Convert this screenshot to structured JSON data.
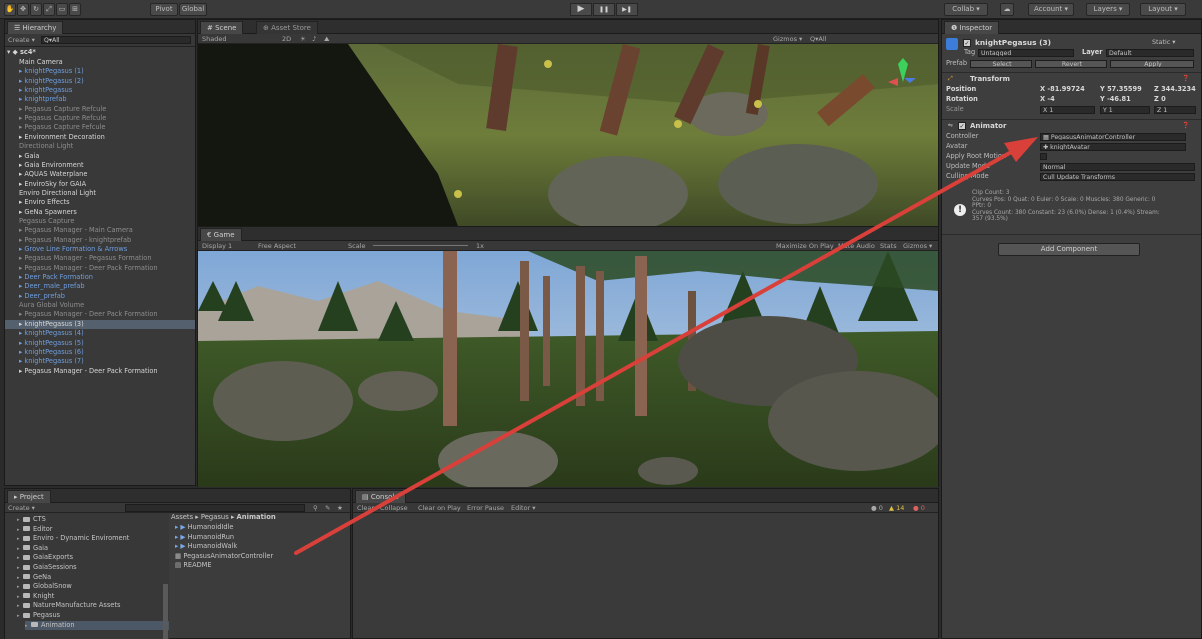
{
  "toolbar": {
    "pivot_label": "Pivot",
    "global_label": "Global",
    "play_icon": "▶",
    "pause_icon": "❚❚",
    "step_icon": "▶❚",
    "collab_label": "Collab ▾",
    "account_label": "Account ▾",
    "layers_label": "Layers ▾",
    "layout_label": "Layout ▾"
  },
  "hierarchy": {
    "tab_label": "☰ Hierarchy",
    "create_label": "Create ▾",
    "search_placeholder": "Q▾All",
    "scene_name": "sc4*",
    "items": [
      {
        "label": "Main Camera",
        "color": "white"
      },
      {
        "label": "▸ knightPegasus (1)",
        "color": "blue"
      },
      {
        "label": "▸ knightPegasus (2)",
        "color": "blue"
      },
      {
        "label": "▸ knightPegasus",
        "color": "blue"
      },
      {
        "label": "▸ knightprefab",
        "color": "blue"
      },
      {
        "label": "▸ Pegasus Capture Refcule",
        "color": "grey"
      },
      {
        "label": "▸ Pegasus Capture Refcule",
        "color": "grey"
      },
      {
        "label": "▸ Pegasus Capture Fefcule",
        "color": "grey"
      },
      {
        "label": "▸ Environment Decoration",
        "color": "white"
      },
      {
        "label": "Directional Light",
        "color": "grey"
      },
      {
        "label": "▸ Gaia",
        "color": "white"
      },
      {
        "label": "▸ Gaia Environment",
        "color": "white"
      },
      {
        "label": "▸ AQUAS Waterplane",
        "color": "white"
      },
      {
        "label": "▸ EnviroSky for GAIA",
        "color": "white"
      },
      {
        "label": "Enviro Directional Light",
        "color": "white"
      },
      {
        "label": "▸ Enviro Effects",
        "color": "white"
      },
      {
        "label": "▸ GeNa Spawners",
        "color": "white"
      },
      {
        "label": "Pegasus Capture",
        "color": "grey"
      },
      {
        "label": "▸ Pegasus Manager - Main Camera",
        "color": "grey"
      },
      {
        "label": "▸ Pegasus Manager - knightprefab",
        "color": "grey"
      },
      {
        "label": "▸ Grove Line Formation & Arrows",
        "color": "blue"
      },
      {
        "label": "▸ Pegasus Manager - Pegasus Formation",
        "color": "grey"
      },
      {
        "label": "▸ Pegasus Manager - Deer Pack Formation",
        "color": "grey"
      },
      {
        "label": "▸ Deer Pack Formation",
        "color": "blue"
      },
      {
        "label": "▸ Deer_male_prefab",
        "color": "blue"
      },
      {
        "label": "▸ Deer_prefab",
        "color": "blue"
      },
      {
        "label": "Aura Global Volume",
        "color": "grey"
      },
      {
        "label": "▸ Pegasus Manager - Deer Pack Formation",
        "color": "grey"
      },
      {
        "label": "▸ knightPegasus (3)",
        "color": "white"
      },
      {
        "label": "▸ knightPegasus (4)",
        "color": "blue"
      },
      {
        "label": "▸ knightPegasus (5)",
        "color": "blue"
      },
      {
        "label": "▸ knightPegasus (6)",
        "color": "blue"
      },
      {
        "label": "▸ knightPegasus (7)",
        "color": "blue"
      },
      {
        "label": "▸ Pegasus Manager - Deer Pack Formation",
        "color": "white"
      }
    ],
    "selected_index": 28
  },
  "scene": {
    "tab_label": "# Scene",
    "asset_store_tab": "⊕ Asset Store",
    "shading_label": "Shaded",
    "mode_2d_label": "2D",
    "gizmos_label": "Gizmos ▾",
    "search_placeholder": "Q▾All"
  },
  "game": {
    "tab_label": "€ Game",
    "display_label": "Display 1",
    "aspect_label": "Free Aspect",
    "scale_label": "Scale",
    "scale_value": "1x",
    "maximize_label": "Maximize On Play",
    "mute_label": "Mute Audio",
    "stats_label": "Stats",
    "gizmos_label": "Gizmos ▾"
  },
  "inspector": {
    "tab_label": "❶ Inspector",
    "object_name": "knightPegasus (3)",
    "static_label": "Static ▾",
    "tag_label": "Tag",
    "tag_value": "Untagged",
    "layer_label": "Layer",
    "layer_value": "Default",
    "prefab_label": "Prefab",
    "select_btn": "Select",
    "revert_btn": "Revert",
    "apply_btn": "Apply",
    "transform_title": "Transform",
    "position_label": "Position",
    "position_x": "X -81.99724",
    "position_y": "Y 57.35599",
    "position_z": "Z 344.3234",
    "rotation_label": "Rotation",
    "rotation_x": "X -4",
    "rotation_y": "Y -46.81",
    "rotation_z": "Z 0",
    "scale_label": "Scale",
    "scale_x": "X 1",
    "scale_y": "Y 1",
    "scale_z": "Z 1",
    "animator_title": "Animator",
    "controller_label": "Controller",
    "controller_value": "PegasusAnimatorController",
    "avatar_label": "Avatar",
    "avatar_value": "knightAvatar",
    "apply_root_label": "Apply Root Motion",
    "update_mode_label": "Update Mode",
    "update_mode_value": "Normal",
    "culling_label": "Culling Mode",
    "culling_value": "Cull Update Transforms",
    "info_line1": "Clip Count: 3",
    "info_line2": "Curves Pos: 0 Quat: 0 Euler: 0 Scale: 0 Muscles: 380 Generic: 0",
    "info_line3": "PPtr: 0",
    "info_line4": "Curves Count: 380 Constant: 23 (6.0%) Dense: 1 (0.4%) Stream:",
    "info_line5": "357 (93.5%)",
    "add_component_btn": "Add Component"
  },
  "project": {
    "tab_label": "▸ Project",
    "create_label": "Create ▾",
    "tree": [
      {
        "label": "CTS",
        "indent": 1
      },
      {
        "label": "Editor",
        "indent": 1
      },
      {
        "label": "Enviro - Dynamic Enviroment",
        "indent": 1
      },
      {
        "label": "Gaia",
        "indent": 1
      },
      {
        "label": "GaiaExports",
        "indent": 1
      },
      {
        "label": "GaiaSessions",
        "indent": 1
      },
      {
        "label": "GeNa",
        "indent": 1
      },
      {
        "label": "GlobalSnow",
        "indent": 1
      },
      {
        "label": "Knight",
        "indent": 1
      },
      {
        "label": "NatureManufacture Assets",
        "indent": 1
      },
      {
        "label": "Pegasus",
        "indent": 1
      },
      {
        "label": "Animation",
        "indent": 2
      }
    ],
    "breadcrumb": [
      "Assets",
      "Pegasus",
      "Animation"
    ],
    "files": [
      {
        "label": "HumanoidIdle",
        "type": "anim"
      },
      {
        "label": "HumanoidRun",
        "type": "anim"
      },
      {
        "label": "HumanoidWalk",
        "type": "anim"
      },
      {
        "label": "PegasusAnimatorController",
        "type": "controller"
      },
      {
        "label": "README",
        "type": "text"
      }
    ]
  },
  "console": {
    "tab_label": "▤ Console",
    "clear_label": "Clear",
    "collapse_label": "Collapse",
    "clear_on_play_label": "Clear on Play",
    "error_pause_label": "Error Pause",
    "editor_label": "Editor ▾",
    "info_count": "0",
    "warn_count": "14",
    "error_count": "0"
  },
  "colors": {
    "annotation_arrow": "#d9403a",
    "selection": "#55606e",
    "prefab_blue": "#6f9fe0"
  }
}
